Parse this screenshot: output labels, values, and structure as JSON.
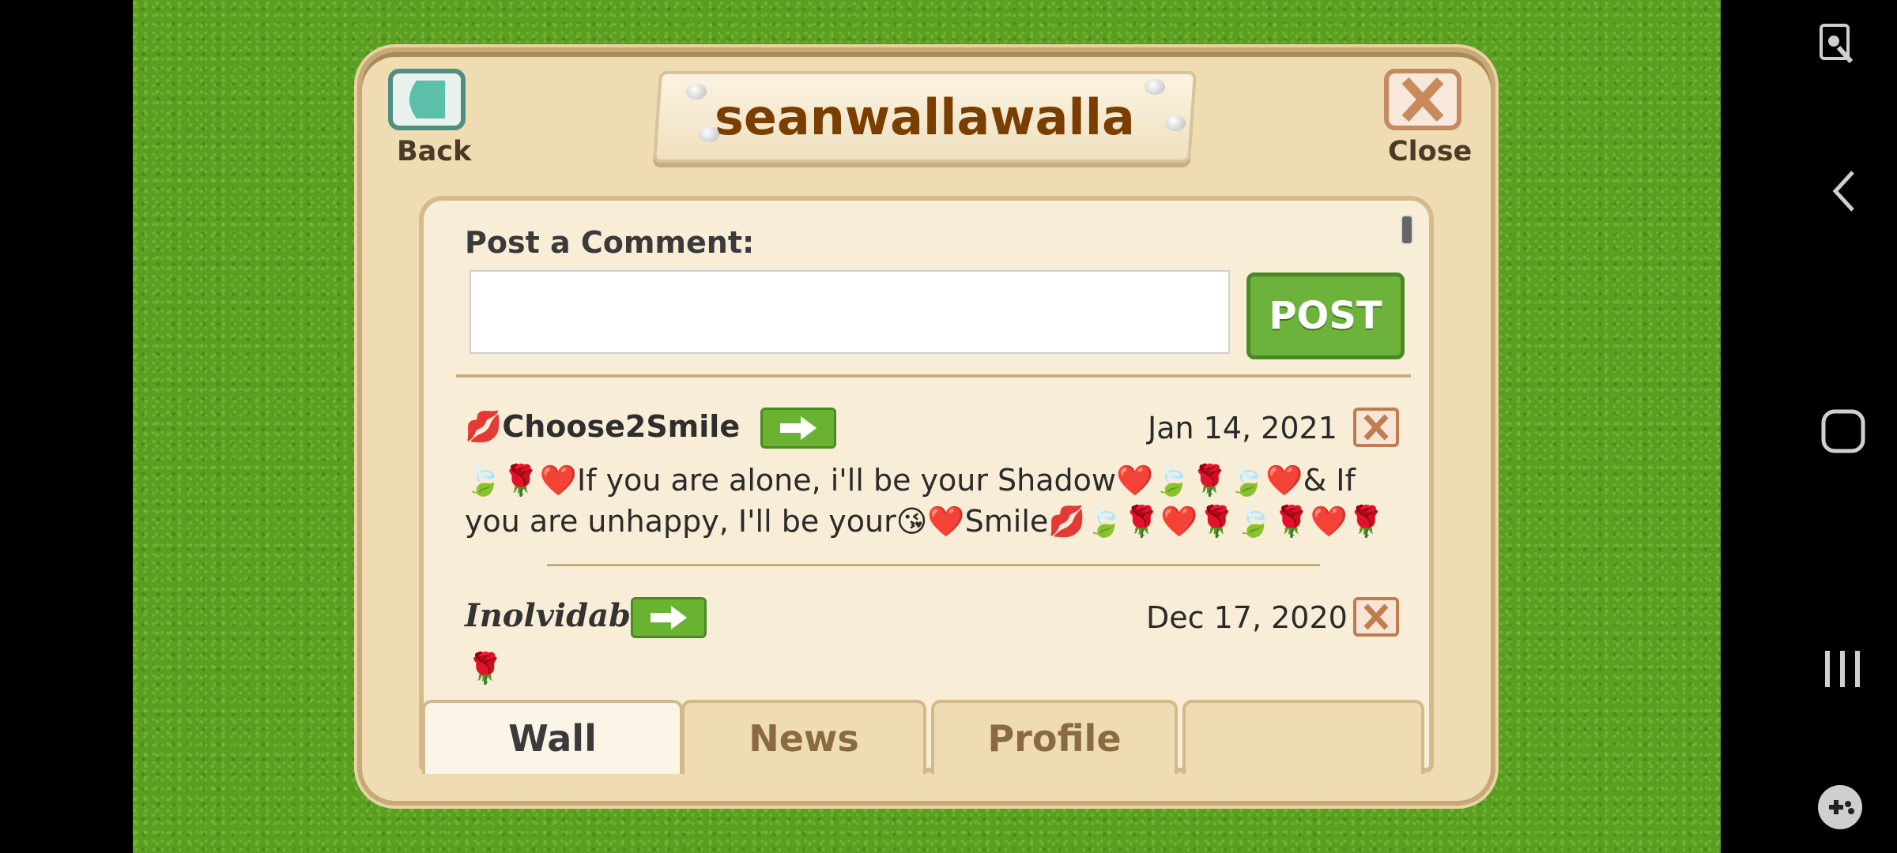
{
  "header": {
    "title": "seanwallawalla",
    "back_label": "Back",
    "close_label": "Close"
  },
  "comment_form": {
    "label": "Post a Comment:",
    "input_value": "",
    "post_label": "POST"
  },
  "posts": [
    {
      "author_emoji": "💋",
      "author": "Choose2Smile",
      "date": "Jan 14, 2021",
      "message_line1": "🍃🌹❤️If you are alone, i'll be your Shadow❤️🍃🌹🍃❤️& If",
      "message_line2": "you are unhappy, I'll be your😘❤️Smile💋🍃🌹❤️🌹🍃🌹❤️🌹"
    },
    {
      "author": "Inolvidable",
      "date": "Dec 17, 2020",
      "message_line1": "🌹"
    }
  ],
  "tabs": [
    {
      "label": "Wall",
      "active": true
    },
    {
      "label": "News",
      "active": false
    },
    {
      "label": "Profile",
      "active": false
    },
    {
      "label": "",
      "active": false
    }
  ],
  "colors": {
    "grass": "#5a9e22",
    "panel": "#efdcb2",
    "post_button": "#6db23a",
    "title_text": "#7a3f00"
  },
  "icons": {
    "back": "triangle-left-icon",
    "close": "x-icon",
    "go": "arrow-right-icon",
    "delete": "x-icon"
  }
}
